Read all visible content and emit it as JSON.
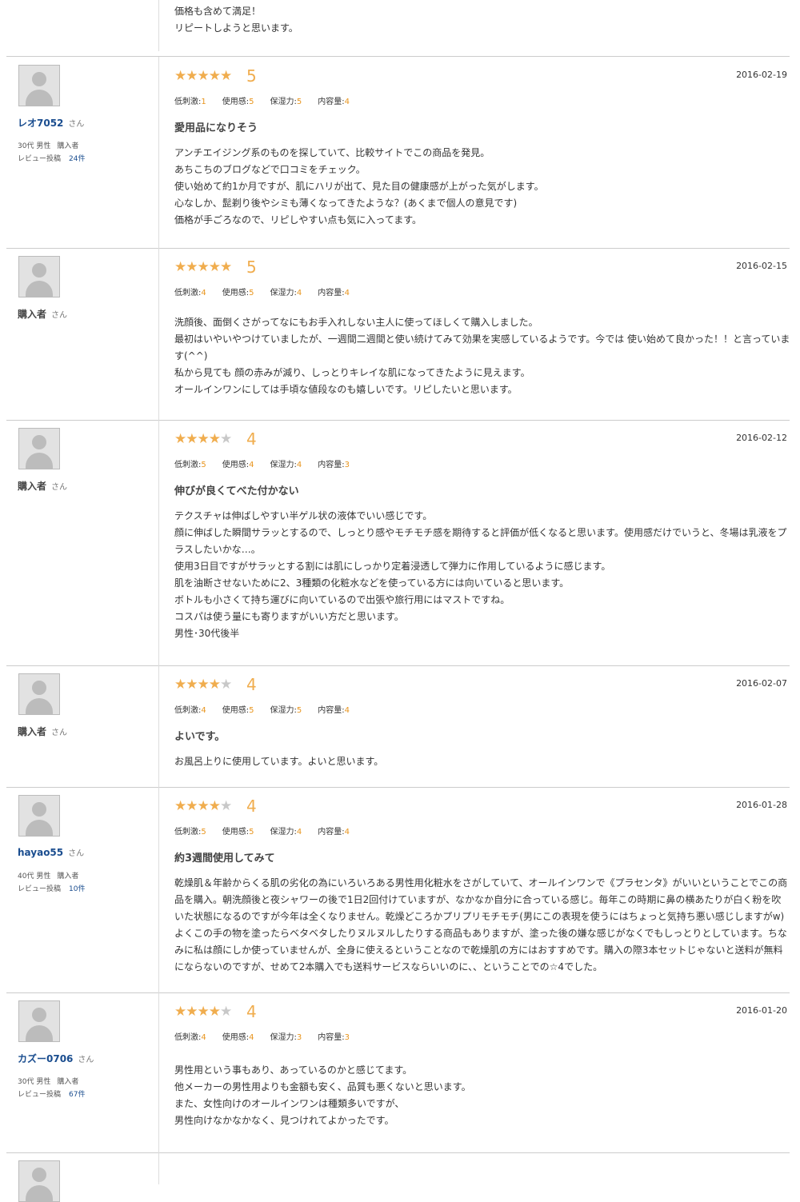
{
  "top_partial": {
    "body": "価格も含めて満足！\nリピートしようと思います。"
  },
  "colors": {
    "star": "#f0ad4e",
    "star_off": "#c8c8c8",
    "link": "#1a4d8f",
    "accent": "#e8951e"
  },
  "labels": {
    "san": "さん",
    "review_count": "レビュー投稿"
  },
  "reviews": [
    {
      "user": "レオ7052",
      "user_link": true,
      "demo": "30代 男性",
      "buyer": "購入者",
      "count": "24件",
      "rating": 5,
      "rating_text": "5",
      "date": "2016-02-19",
      "criteria": [
        {
          "label": "低刺激:",
          "value": "1"
        },
        {
          "label": "使用感:",
          "value": "5"
        },
        {
          "label": "保湿力:",
          "value": "5"
        },
        {
          "label": "内容量:",
          "value": "4"
        }
      ],
      "title": "愛用品になりそう",
      "body": "アンチエイジング系のものを探していて、比較サイトでこの商品を発見。\nあちこちのブログなどで口コミをチェック。\n使い始めて約1か月ですが、肌にハリが出て、見た目の健康感が上がった気がします。\n心なしか、髭剃り後やシミも薄くなってきたような？(あくまで個人の意見です)\n価格が手ごろなので、リピしやすい点も気に入ってます。"
    },
    {
      "user": "購入者",
      "user_link": false,
      "demo": "",
      "buyer": "",
      "count": "",
      "rating": 5,
      "rating_text": "5",
      "date": "2016-02-15",
      "criteria": [
        {
          "label": "低刺激:",
          "value": "4"
        },
        {
          "label": "使用感:",
          "value": "5"
        },
        {
          "label": "保湿力:",
          "value": "4"
        },
        {
          "label": "内容量:",
          "value": "4"
        }
      ],
      "title": "",
      "body": "洗顔後、面倒くさがってなにもお手入れしない主人に使ってほしくて購入しました。\n最初はいやいやつけていましたが、一週間二週間と使い続けてみて効果を実感しているようです。今では 使い始めて良かった！！と言っています(^^)\n私から見ても 顔の赤みが減り、しっとりキレイな肌になってきたように見えます。\nオールインワンにしては手頃な値段なのも嬉しいです。リピしたいと思います。"
    },
    {
      "user": "購入者",
      "user_link": false,
      "demo": "",
      "buyer": "",
      "count": "",
      "rating": 4,
      "rating_text": "4",
      "date": "2016-02-12",
      "criteria": [
        {
          "label": "低刺激:",
          "value": "5"
        },
        {
          "label": "使用感:",
          "value": "4"
        },
        {
          "label": "保湿力:",
          "value": "4"
        },
        {
          "label": "内容量:",
          "value": "3"
        }
      ],
      "title": "伸びが良くてべた付かない",
      "body": "テクスチャは伸ばしやすい半ゲル状の液体でいい感じです。\n顔に伸ばした瞬間サラッとするので、しっとり感やモチモチ感を期待すると評価が低くなると思います。使用感だけでいうと、冬場は乳液をプラスしたいかな…。\n使用3日目ですがサラッとする割には肌にしっかり定着浸透して弾力に作用しているように感じます。\n肌を油断させないために2、3種類の化粧水などを使っている方には向いていると思います。\nボトルも小さくて持ち運びに向いているので出張や旅行用にはマストですね。\nコスパは使う量にも寄りますがいい方だと思います。\n男性･30代後半"
    },
    {
      "user": "購入者",
      "user_link": false,
      "demo": "",
      "buyer": "",
      "count": "",
      "rating": 4,
      "rating_text": "4",
      "date": "2016-02-07",
      "criteria": [
        {
          "label": "低刺激:",
          "value": "4"
        },
        {
          "label": "使用感:",
          "value": "5"
        },
        {
          "label": "保湿力:",
          "value": "5"
        },
        {
          "label": "内容量:",
          "value": "4"
        }
      ],
      "title": "よいです。",
      "body": "お風呂上りに使用しています。よいと思います。"
    },
    {
      "user": "hayao55",
      "user_link": true,
      "demo": "40代 男性",
      "buyer": "購入者",
      "count": "10件",
      "rating": 4,
      "rating_text": "4",
      "date": "2016-01-28",
      "criteria": [
        {
          "label": "低刺激:",
          "value": "5"
        },
        {
          "label": "使用感:",
          "value": "5"
        },
        {
          "label": "保湿力:",
          "value": "4"
        },
        {
          "label": "内容量:",
          "value": "4"
        }
      ],
      "title": "約3週間使用してみて",
      "body": "乾燥肌＆年齢からくる肌の劣化の為にいろいろある男性用化粧水をさがしていて、オールインワンで《プラセンタ》がいいということでこの商品を購入。朝洗顔後と夜シャワーの後で1日2回付けていますが、なかなか自分に合っている感じ。毎年この時期に鼻の横あたりが白く粉を吹いた状態になるのですが今年は全くなりません。乾燥どころかプリプリモチモチ(男にこの表現を使うにはちょっと気持ち悪い感じしますがw) よくこの手の物を塗ったらベタベタしたりヌルヌルしたりする商品もありますが、塗った後の嫌な感じがなくでもしっとりとしています。ちなみに私は顔にしか使っていませんが、全身に使えるということなので乾燥肌の方にはおすすめです。購入の際3本セットじゃないと送料が無料にならないのですが、せめて2本購入でも送料サービスならいいのに、、ということでの☆4でした。"
    },
    {
      "user": "カズー0706",
      "user_link": true,
      "demo": "30代 男性",
      "buyer": "購入者",
      "count": "67件",
      "rating": 4,
      "rating_text": "4",
      "date": "2016-01-20",
      "criteria": [
        {
          "label": "低刺激:",
          "value": "4"
        },
        {
          "label": "使用感:",
          "value": "4"
        },
        {
          "label": "保湿力:",
          "value": "3"
        },
        {
          "label": "内容量:",
          "value": "3"
        }
      ],
      "title": "",
      "body": "男性用という事もあり、あっているのかと感じてます。\n他メーカーの男性用よりも金額も安く、品質も悪くないと思います。\nまた、女性向けのオールインワンは種類多いですが、\n男性向けなかなかなく、見つけれてよかったです。"
    }
  ]
}
